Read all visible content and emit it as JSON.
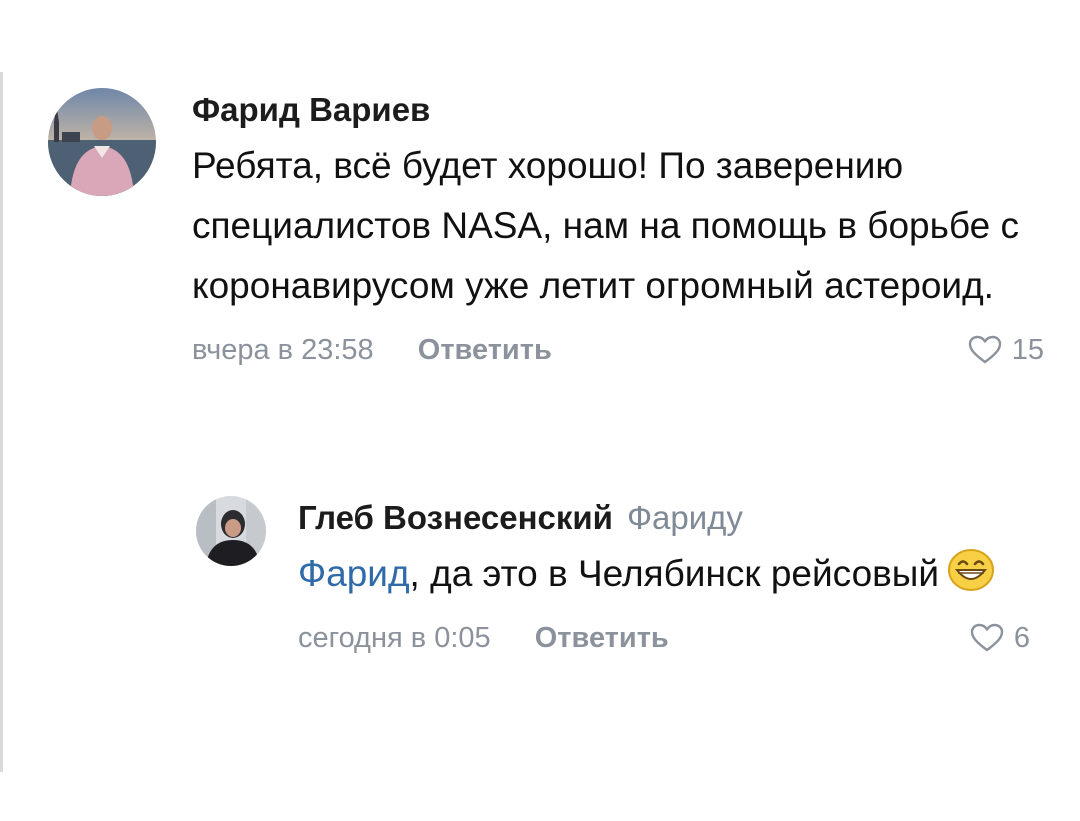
{
  "comments": [
    {
      "author": "Фарид Вариев",
      "text": "Ребята, всё будет хорошо! По заверению специалистов NASA, нам на помощь в борьбе с коронавирусом уже летит огромный астероид.",
      "timestamp": "вчера в 23:58",
      "reply_label": "Ответить",
      "likes": "15",
      "avatar_icon": "user-photo-icon"
    },
    {
      "author": "Глеб Вознесенский",
      "reply_to": "Фариду",
      "mention": "Фарид",
      "text": ", да это в Челябинск рейсовый",
      "emoji": "grinning-face-emoji",
      "timestamp": "сегодня в 0:05",
      "reply_label": "Ответить",
      "likes": "6",
      "avatar_icon": "user-photo-icon"
    }
  ],
  "colors": {
    "mention": "#2f6ba8",
    "meta": "#8b929c",
    "author": "#1c1c1c",
    "text": "#111111"
  }
}
